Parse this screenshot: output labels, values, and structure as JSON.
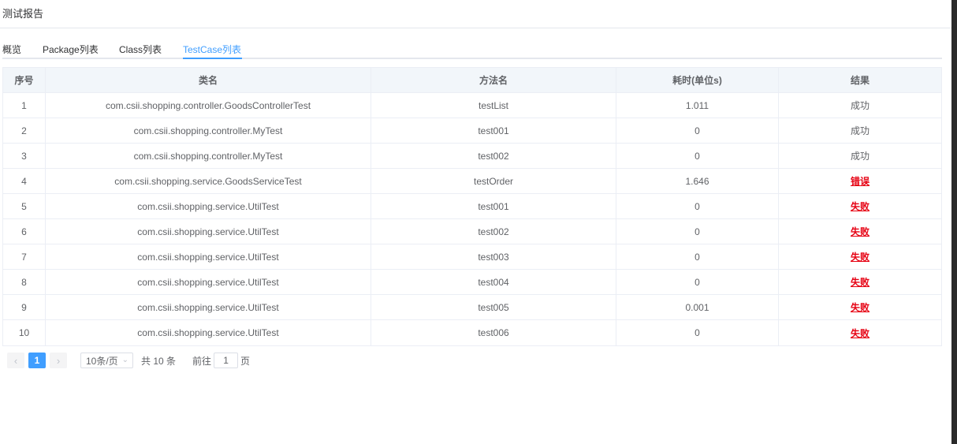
{
  "header": {
    "title": "测试报告"
  },
  "tabs": [
    {
      "label": "概览"
    },
    {
      "label": "Package列表"
    },
    {
      "label": "Class列表"
    },
    {
      "label": "TestCase列表"
    }
  ],
  "table": {
    "columns": [
      "序号",
      "类名",
      "方法名",
      "耗时(单位s)",
      "结果"
    ],
    "rows": [
      [
        "1",
        "com.csii.shopping.controller.GoodsControllerTest",
        "testList",
        "1.011",
        "成功"
      ],
      [
        "2",
        "com.csii.shopping.controller.MyTest",
        "test001",
        "0",
        "成功"
      ],
      [
        "3",
        "com.csii.shopping.controller.MyTest",
        "test002",
        "0",
        "成功"
      ],
      [
        "4",
        "com.csii.shopping.service.GoodsServiceTest",
        "testOrder",
        "1.646",
        "错误"
      ],
      [
        "5",
        "com.csii.shopping.service.UtilTest",
        "test001",
        "0",
        "失败"
      ],
      [
        "6",
        "com.csii.shopping.service.UtilTest",
        "test002",
        "0",
        "失败"
      ],
      [
        "7",
        "com.csii.shopping.service.UtilTest",
        "test003",
        "0",
        "失败"
      ],
      [
        "8",
        "com.csii.shopping.service.UtilTest",
        "test004",
        "0",
        "失败"
      ],
      [
        "9",
        "com.csii.shopping.service.UtilTest",
        "test005",
        "0.001",
        "失败"
      ],
      [
        "10",
        "com.csii.shopping.service.UtilTest",
        "test006",
        "0",
        "失败"
      ]
    ]
  },
  "pagination": {
    "prev_icon": "chevron-left-icon",
    "current_page": "1",
    "next_icon": "chevron-right-icon",
    "page_size": "10条/页",
    "total": "共 10 条",
    "goto_label": "前往",
    "goto_value": "1",
    "goto_unit": "页"
  },
  "colors": {
    "accent": "#409eff",
    "fail": "#e60012",
    "header_bg": "#f2f6fa"
  }
}
